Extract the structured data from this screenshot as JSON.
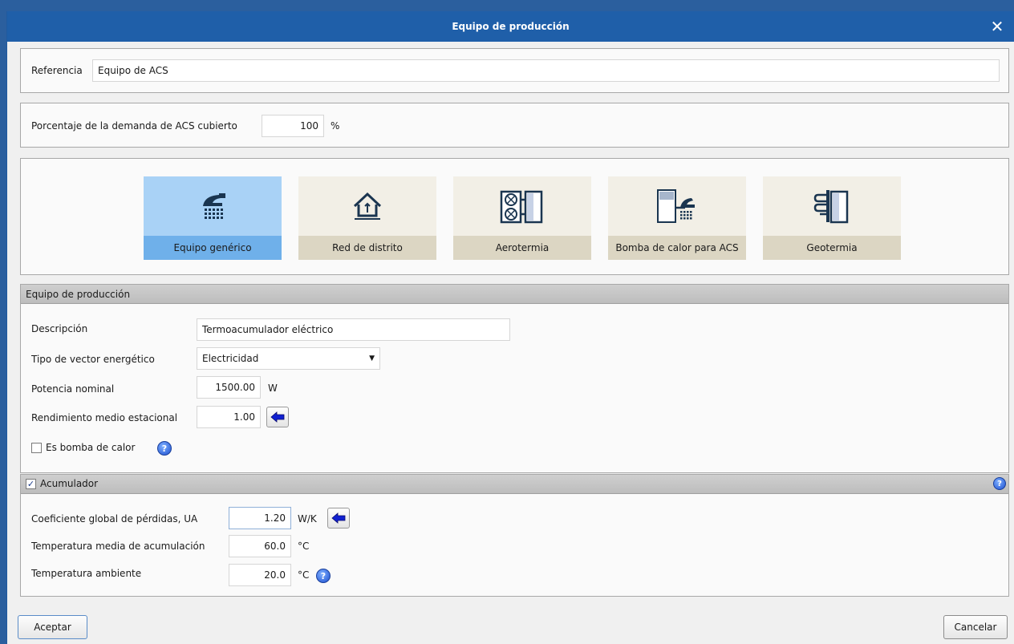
{
  "window": {
    "title": "Equipo de producción"
  },
  "reference": {
    "label": "Referencia",
    "value": "Equipo de ACS"
  },
  "demand": {
    "label": "Porcentaje de la demanda de ACS cubierto",
    "value": "100",
    "unit": "%"
  },
  "equipment_types": [
    {
      "label": "Equipo genérico",
      "icon": "shower-icon",
      "selected": true
    },
    {
      "label": "Red de distrito",
      "icon": "district-network-icon",
      "selected": false
    },
    {
      "label": "Aerotermia",
      "icon": "aerothermal-unit-icon",
      "selected": false
    },
    {
      "label": "Bomba de calor para ACS",
      "icon": "heat-pump-dhw-icon",
      "selected": false
    },
    {
      "label": "Geotermia",
      "icon": "geothermal-icon",
      "selected": false
    }
  ],
  "production": {
    "header": "Equipo de producción",
    "description": {
      "label": "Descripción",
      "value": "Termoacumulador eléctrico"
    },
    "vector": {
      "label": "Tipo de vector energético",
      "value": "Electricidad"
    },
    "power": {
      "label": "Potencia nominal",
      "value": "1500.00",
      "unit": "W"
    },
    "efficiency": {
      "label": "Rendimiento medio estacional",
      "value": "1.00"
    },
    "heat_pump": {
      "label": "Es bomba de calor",
      "checked": false
    }
  },
  "accumulator": {
    "header": "Acumulador",
    "checked": true,
    "loss_coef": {
      "label": "Coeficiente global de pérdidas, UA",
      "value": "1.20",
      "unit": "W/K"
    },
    "avg_temp": {
      "label": "Temperatura media de acumulación",
      "value": "60.0",
      "unit": "°C"
    },
    "ambient_temp": {
      "label": "Temperatura ambiente",
      "value": "20.0",
      "unit": "°C"
    }
  },
  "buttons": {
    "accept": "Aceptar",
    "cancel": "Cancelar"
  },
  "colors": {
    "titlebar": "#1f5fa9",
    "selected_tile": "#6fb0ea",
    "tile": "#dcd6c3"
  }
}
